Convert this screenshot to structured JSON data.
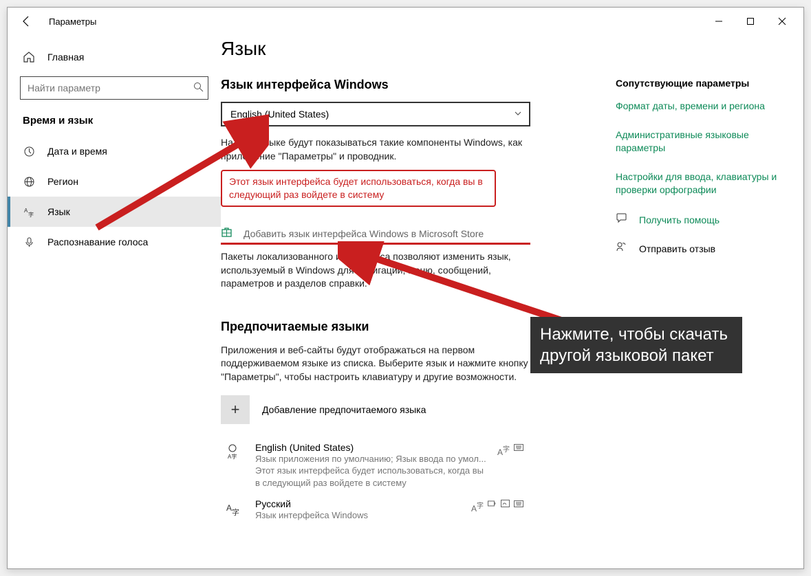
{
  "window": {
    "title": "Параметры"
  },
  "sidebar": {
    "home": "Главная",
    "search_placeholder": "Найти параметр",
    "section": "Время и язык",
    "items": [
      {
        "icon": "clock",
        "label": "Дата и время"
      },
      {
        "icon": "globe",
        "label": "Регион"
      },
      {
        "icon": "lang",
        "label": "Язык"
      },
      {
        "icon": "mic",
        "label": "Распознавание голоса"
      }
    ]
  },
  "main": {
    "title": "Язык",
    "display_lang": {
      "heading": "Язык интерфейса Windows",
      "selected": "English (United States)",
      "desc": "На этом языке будут показываться такие компоненты Windows, как приложение \"Параметры\" и проводник.",
      "notice": "Этот язык интерфейса будет использоваться, когда вы в следующий раз войдете в систему",
      "store_link": "Добавить язык интерфейса Windows в Microsoft Store",
      "store_desc": "Пакеты локализованного интерфейса позволяют изменить язык, используемый в Windows для навигации, меню, сообщений, параметров и разделов справки."
    },
    "preferred": {
      "heading": "Предпочитаемые языки",
      "desc": "Приложения и веб-сайты будут отображаться на первом поддерживаемом языке из списка. Выберите язык и нажмите кнопку \"Параметры\", чтобы настроить клавиатуру и другие возможности.",
      "add_label": "Добавление предпочитаемого языка",
      "items": [
        {
          "name": "English (United States)",
          "sub1": "Язык приложения по умолчанию; Язык ввода по умол...",
          "sub2": "Этот язык интерфейса будет использоваться, когда вы в следующий раз войдете в систему"
        },
        {
          "name": "Русский",
          "sub1": "Язык интерфейса Windows"
        }
      ]
    }
  },
  "rightcol": {
    "heading": "Сопутствующие параметры",
    "links": [
      "Формат даты, времени и региона",
      "Административные языковые параметры",
      "Настройки для ввода, клавиатуры и проверки орфографии"
    ],
    "help": "Получить помощь",
    "feedback": "Отправить отзыв"
  },
  "annotation": {
    "callout": "Нажмите, чтобы скачать другой языковой пакет"
  }
}
